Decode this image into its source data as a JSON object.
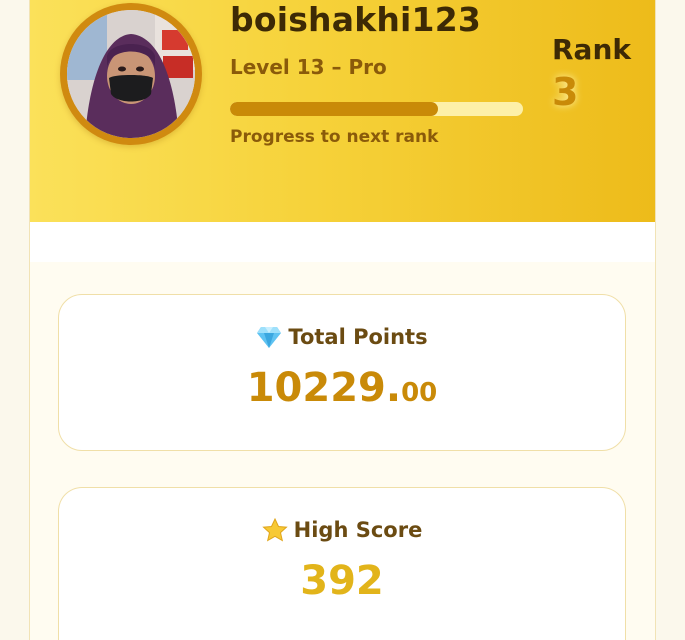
{
  "profile": {
    "username": "boishakhi123",
    "level": "Level 13 – Pro",
    "progress_caption": "Progress to next rank",
    "progress_fraction": 0.71
  },
  "rank": {
    "label": "Rank",
    "value": "3"
  },
  "stats": {
    "total_points": {
      "icon": "diamond-icon",
      "label": "Total Points",
      "value_int": "10229.",
      "value_dec": "00"
    },
    "high_score": {
      "icon": "star-icon",
      "label": "High Score",
      "value": "392"
    }
  },
  "colors": {
    "hero_gradient_start": "#fbe15a",
    "hero_gradient_end": "#edbb1a",
    "accent": "#c98a08",
    "high_score": "#e2b41a",
    "dark_text": "#3d2a05"
  }
}
